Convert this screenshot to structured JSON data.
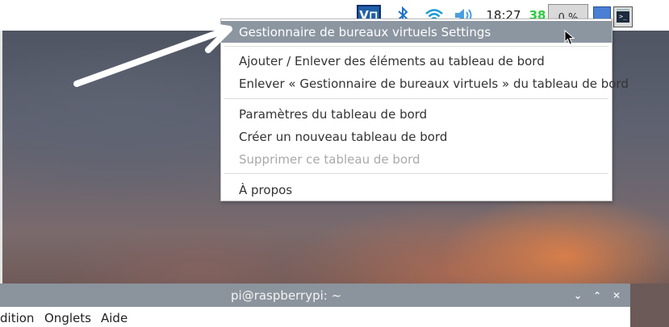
{
  "taskbar": {
    "vnc_label": "V⊓",
    "bluetooth_icon": "bluetooth-icon",
    "wifi_icon": "wifi-icon",
    "volume_icon": "volume-icon",
    "clock": "18:27",
    "cpu_value": "38",
    "cpu_box_label": "0 %",
    "accent_vnc": "#1f5fa8",
    "accent_cpu": "#2ecc40"
  },
  "context_menu": {
    "items": [
      {
        "label": "Gestionnaire de bureaux virtuels Settings",
        "state": "highlighted"
      },
      {
        "label": "Ajouter / Enlever des éléments au tableau de bord",
        "state": "normal"
      },
      {
        "label": "Enlever « Gestionnaire de bureaux virtuels » du tableau de bord",
        "state": "normal"
      },
      {
        "label": "Paramètres du tableau de bord",
        "state": "normal"
      },
      {
        "label": "Créer un nouveau tableau de bord",
        "state": "normal"
      },
      {
        "label": "Supprimer ce tableau de bord",
        "state": "disabled"
      },
      {
        "label": "À propos",
        "state": "normal"
      }
    ],
    "highlight_color": "#8c96a1"
  },
  "terminal": {
    "title": "pi@raspberrypi: ~",
    "menu": [
      "dition",
      "Onglets",
      "Aide"
    ],
    "controls": [
      "⌄",
      "⌃",
      "✕"
    ]
  }
}
